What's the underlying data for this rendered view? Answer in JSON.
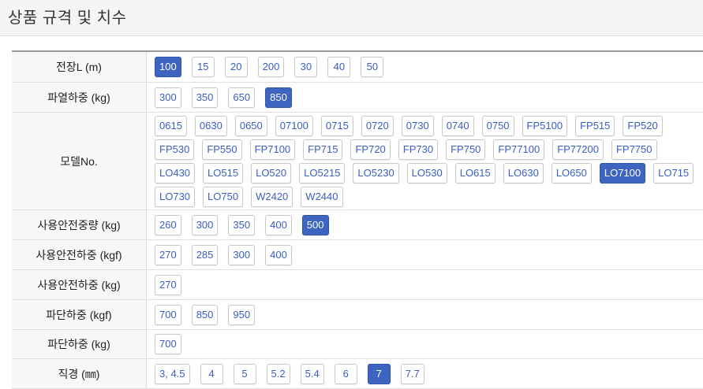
{
  "header": {
    "title": "상품 규격 및 치수"
  },
  "colors": {
    "accent": "#3d64bf",
    "option_text": "#3a5ec2"
  },
  "rows": [
    {
      "label": "전장L (m)",
      "options": [
        "100",
        "15",
        "20",
        "200",
        "30",
        "40",
        "50"
      ],
      "selected": "100"
    },
    {
      "label": "파열하중 (kg)",
      "options": [
        "300",
        "350",
        "650",
        "850"
      ],
      "selected": "850"
    },
    {
      "label": "모델No.",
      "options": [
        "0615",
        "0630",
        "0650",
        "07100",
        "0715",
        "0720",
        "0730",
        "0740",
        "0750",
        "FP5100",
        "FP515",
        "FP520",
        "FP530",
        "FP550",
        "FP7100",
        "FP715",
        "FP720",
        "FP730",
        "FP750",
        "FP77100",
        "FP77200",
        "FP7750",
        "LO430",
        "LO515",
        "LO520",
        "LO5215",
        "LO5230",
        "LO530",
        "LO615",
        "LO630",
        "LO650",
        "LO7100",
        "LO715",
        "LO730",
        "LO750",
        "W2420",
        "W2440"
      ],
      "selected": "LO7100"
    },
    {
      "label": "사용안전중량 (kg)",
      "options": [
        "260",
        "300",
        "350",
        "400",
        "500"
      ],
      "selected": "500"
    },
    {
      "label": "사용안전하중 (kgf)",
      "options": [
        "270",
        "285",
        "300",
        "400"
      ],
      "selected": ""
    },
    {
      "label": "사용안전하중 (kg)",
      "options": [
        "270"
      ],
      "selected": ""
    },
    {
      "label": "파단하중 (kgf)",
      "options": [
        "700",
        "850",
        "950"
      ],
      "selected": ""
    },
    {
      "label": "파단하중 (kg)",
      "options": [
        "700"
      ],
      "selected": ""
    },
    {
      "label": "직경 (㎜)",
      "options": [
        "3, 4.5",
        "4",
        "5",
        "5.2",
        "5.4",
        "6",
        "7",
        "7.7"
      ],
      "selected": "7"
    }
  ]
}
